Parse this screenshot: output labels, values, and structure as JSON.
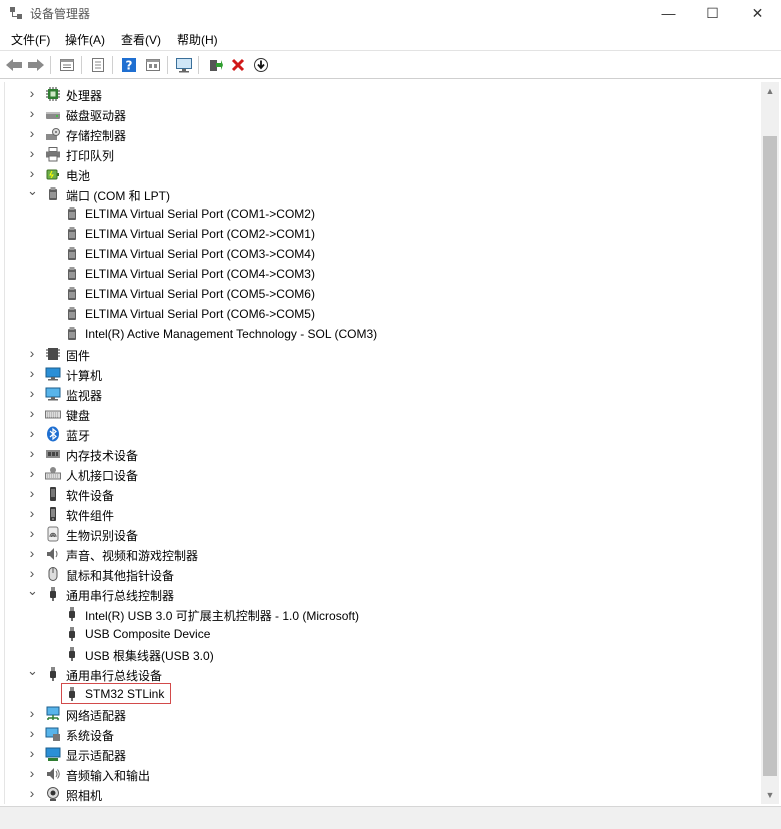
{
  "window": {
    "title": "设备管理器",
    "minimize": "—",
    "maximize": "☐",
    "close": "✕"
  },
  "menu": [
    "文件(F)",
    "操作(A)",
    "查看(V)",
    "帮助(H)"
  ],
  "toolbar": [
    "back-icon",
    "forward-icon",
    "properties-icon",
    "refresh-icon",
    "help-icon",
    "view-icon",
    "monitor-icon",
    "update-driver-icon",
    "uninstall-icon",
    "download-icon"
  ],
  "tree": [
    {
      "label": "处理器",
      "icon": "cpu-icon",
      "level": 0,
      "expanded": false
    },
    {
      "label": "磁盘驱动器",
      "icon": "disk-icon",
      "level": 0,
      "expanded": false
    },
    {
      "label": "存储控制器",
      "icon": "storage-icon",
      "level": 0,
      "expanded": false
    },
    {
      "label": "打印队列",
      "icon": "printer-icon",
      "level": 0,
      "expanded": false
    },
    {
      "label": "电池",
      "icon": "battery-icon",
      "level": 0,
      "expanded": false
    },
    {
      "label": "端口 (COM 和 LPT)",
      "icon": "port-icon",
      "level": 0,
      "expanded": true
    },
    {
      "label": "ELTIMA Virtual Serial Port (COM1->COM2)",
      "icon": "port-icon",
      "level": 1
    },
    {
      "label": "ELTIMA Virtual Serial Port (COM2->COM1)",
      "icon": "port-icon",
      "level": 1
    },
    {
      "label": "ELTIMA Virtual Serial Port (COM3->COM4)",
      "icon": "port-icon",
      "level": 1
    },
    {
      "label": "ELTIMA Virtual Serial Port (COM4->COM3)",
      "icon": "port-icon",
      "level": 1
    },
    {
      "label": "ELTIMA Virtual Serial Port (COM5->COM6)",
      "icon": "port-icon",
      "level": 1
    },
    {
      "label": "ELTIMA Virtual Serial Port (COM6->COM5)",
      "icon": "port-icon",
      "level": 1
    },
    {
      "label": "Intel(R) Active Management Technology - SOL (COM3)",
      "icon": "port-icon",
      "level": 1
    },
    {
      "label": "固件",
      "icon": "firmware-icon",
      "level": 0,
      "expanded": false
    },
    {
      "label": "计算机",
      "icon": "computer-icon",
      "level": 0,
      "expanded": false
    },
    {
      "label": "监视器",
      "icon": "monitor-icon",
      "level": 0,
      "expanded": false
    },
    {
      "label": "键盘",
      "icon": "keyboard-icon",
      "level": 0,
      "expanded": false
    },
    {
      "label": "蓝牙",
      "icon": "bluetooth-icon",
      "level": 0,
      "expanded": false
    },
    {
      "label": "内存技术设备",
      "icon": "memory-icon",
      "level": 0,
      "expanded": false
    },
    {
      "label": "人机接口设备",
      "icon": "hid-icon",
      "level": 0,
      "expanded": false
    },
    {
      "label": "软件设备",
      "icon": "software-device-icon",
      "level": 0,
      "expanded": false
    },
    {
      "label": "软件组件",
      "icon": "software-component-icon",
      "level": 0,
      "expanded": false
    },
    {
      "label": "生物识别设备",
      "icon": "fingerprint-icon",
      "level": 0,
      "expanded": false
    },
    {
      "label": "声音、视频和游戏控制器",
      "icon": "speaker-icon",
      "level": 0,
      "expanded": false
    },
    {
      "label": "鼠标和其他指针设备",
      "icon": "mouse-icon",
      "level": 0,
      "expanded": false
    },
    {
      "label": "通用串行总线控制器",
      "icon": "usb-icon",
      "level": 0,
      "expanded": true
    },
    {
      "label": "Intel(R) USB 3.0 可扩展主机控制器 - 1.0 (Microsoft)",
      "icon": "usb-icon",
      "level": 1
    },
    {
      "label": "USB Composite Device",
      "icon": "usb-icon",
      "level": 1
    },
    {
      "label": "USB 根集线器(USB 3.0)",
      "icon": "usb-icon",
      "level": 1
    },
    {
      "label": "通用串行总线设备",
      "icon": "usb-icon",
      "level": 0,
      "expanded": true
    },
    {
      "label": "STM32 STLink",
      "icon": "usb-icon",
      "level": 1,
      "highlighted": true
    },
    {
      "label": "网络适配器",
      "icon": "network-icon",
      "level": 0,
      "expanded": false
    },
    {
      "label": "系统设备",
      "icon": "system-icon",
      "level": 0,
      "expanded": false
    },
    {
      "label": "显示适配器",
      "icon": "display-adapter-icon",
      "level": 0,
      "expanded": false
    },
    {
      "label": "音频输入和输出",
      "icon": "audio-icon",
      "level": 0,
      "expanded": false
    },
    {
      "label": "照相机",
      "icon": "camera-icon",
      "level": 0,
      "expanded": false
    }
  ],
  "colors": {
    "highlight_border": "#d24a4a",
    "toolbar_blue": "#1f6fd1",
    "uninstall_red": "#d01818",
    "update_green": "#2f9e2f"
  }
}
